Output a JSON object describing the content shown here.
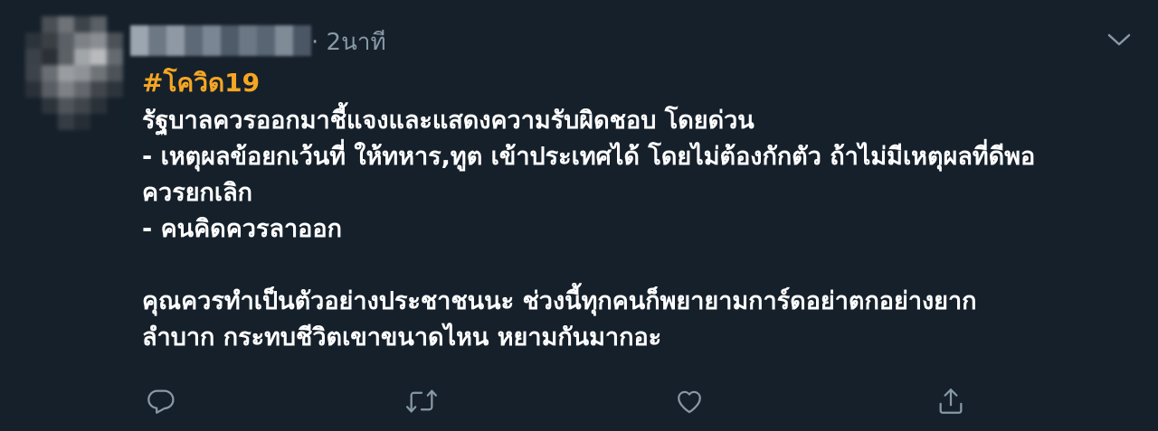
{
  "tweet": {
    "timestamp": "· 2นาที",
    "hashtag": "#โควิด19",
    "lines": [
      "รัฐบาลควรออกมาชี้แจงและแสดงความรับผิดชอบ โดยด่วน",
      "- เหตุผลข้อยกเว้นที่ ให้ทหาร,ทูต เข้าประเทศได้ โดยไม่ต้องกักตัว ถ้าไม่มีเหตุผลที่ดีพอ",
      "ควรยกเลิก",
      "- คนคิดควรลาออก",
      "",
      "คุณควรทำเป็นตัวอย่างประชาชนนะ ช่วงนี้ทุกคนก็พยายามการ์ดอย่าตกอย่างยาก",
      "ลำบาก กระทบชีวิตเขาขนาดไหน หยามกันมากอะ"
    ],
    "hashtag_color": "#f5a623",
    "text_color": "#ffffff",
    "muted_color": "#8899a6",
    "background": "#15202b"
  },
  "actions": [
    {
      "icon": "reply-icon"
    },
    {
      "icon": "retweet-icon"
    },
    {
      "icon": "like-icon"
    },
    {
      "icon": "share-icon"
    }
  ],
  "menu": {
    "icon": "chevron-down-icon"
  }
}
